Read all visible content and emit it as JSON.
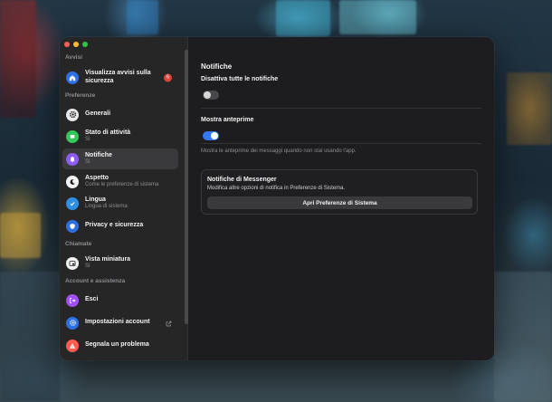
{
  "colors": {
    "accent": "#3478f6",
    "badge": "#e0453a",
    "sidebar_bg": "#262627",
    "window_bg": "#1d1d1f"
  },
  "sidebar": {
    "sections": [
      {
        "label": "Avvisi"
      },
      {
        "label": "Preferenze"
      },
      {
        "label": "Chiamate"
      },
      {
        "label": "Account e assistenza"
      }
    ],
    "items": [
      {
        "label": "Visualizza avvisi sulla sicurezza",
        "icon": "home-icon",
        "icon_color": "#2f6fe4",
        "badge": "6"
      },
      {
        "label": "Generali",
        "icon": "gear-icon",
        "icon_color": "#e8e8e8"
      },
      {
        "label": "Stato di attività",
        "sub": "Sì",
        "icon": "activity-status-icon",
        "icon_color": "#34c759"
      },
      {
        "label": "Notifiche",
        "sub": "Sì",
        "icon": "bell-icon",
        "icon_color": "#8e5cf5"
      },
      {
        "label": "Aspetto",
        "sub": "Come le preferenze di sistema",
        "icon": "moon-icon",
        "icon_color": "#f2f2f2"
      },
      {
        "label": "Lingua",
        "sub": "Lingua di sistema",
        "icon": "globe-icon",
        "icon_color": "#2f8fe4"
      },
      {
        "label": "Privacy e sicurezza",
        "icon": "shield-icon",
        "icon_color": "#2f6fe4"
      },
      {
        "label": "Vista miniatura",
        "sub": "Sì",
        "icon": "picture-in-picture-icon",
        "icon_color": "#f2f2f2"
      },
      {
        "label": "Esci",
        "icon": "logout-icon",
        "icon_color": "#a24ff0"
      },
      {
        "label": "Impostazioni account",
        "icon": "account-settings-icon",
        "icon_color": "#2f6fe4",
        "external_icon": "external-link-icon"
      },
      {
        "label": "Segnala un problema",
        "icon": "warning-icon",
        "icon_color": "#ff5a4f"
      }
    ]
  },
  "main": {
    "title": "Notifiche",
    "disable_all": {
      "label": "Disattiva tutte le notifiche",
      "enabled": false
    },
    "previews": {
      "label": "Mostra anteprime",
      "enabled": true,
      "hint": "Mostra le anteprime dei messaggi quando non stai usando l'app."
    },
    "messenger_card": {
      "title": "Notifiche di Messenger",
      "description": "Modifica altre opzioni di notifica in Preferenze di Sistema.",
      "button_label": "Apri Preferenze di Sistema"
    }
  }
}
